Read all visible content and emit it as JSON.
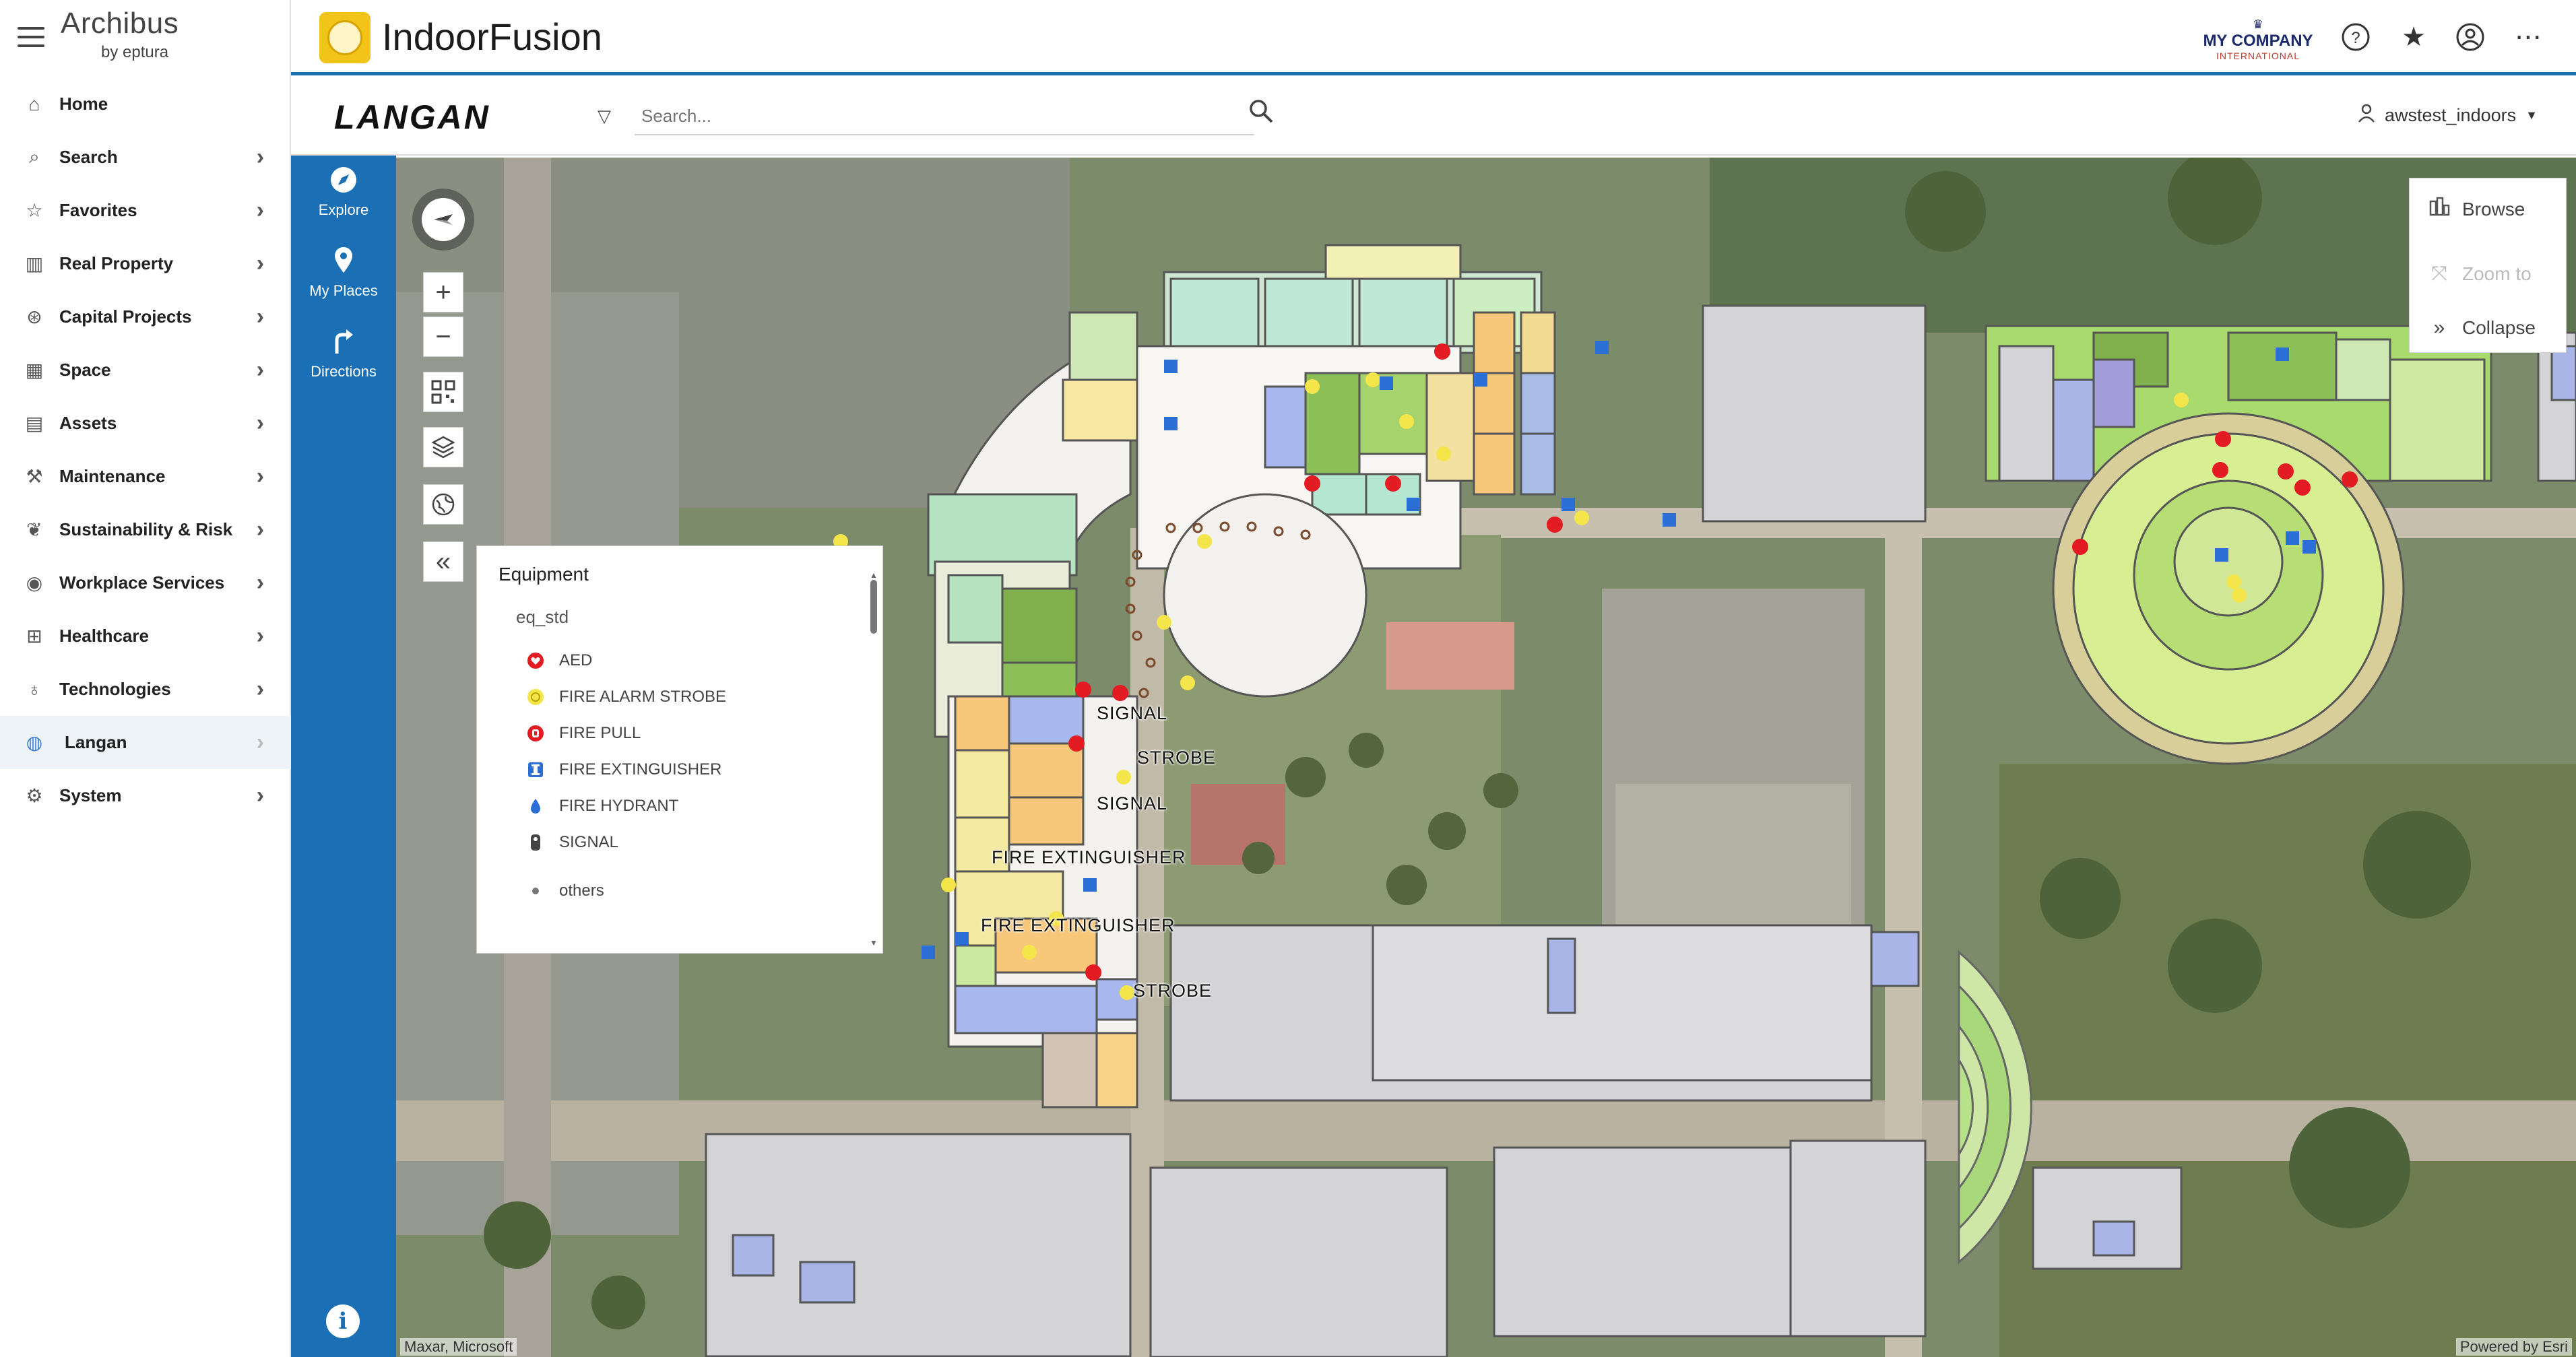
{
  "brand": {
    "name": "Archibus",
    "sub": "by eptura"
  },
  "nav": {
    "items": [
      {
        "label": "Home",
        "icon": "home-icon",
        "chevron": false
      },
      {
        "label": "Search",
        "icon": "search-icon",
        "chevron": true
      },
      {
        "label": "Favorites",
        "icon": "star-icon",
        "chevron": true
      },
      {
        "label": "Real Property",
        "icon": "building-icon",
        "chevron": true
      },
      {
        "label": "Capital Projects",
        "icon": "money-icon",
        "chevron": true
      },
      {
        "label": "Space",
        "icon": "floorplan-icon",
        "chevron": true
      },
      {
        "label": "Assets",
        "icon": "clipboard-icon",
        "chevron": true
      },
      {
        "label": "Maintenance",
        "icon": "wrench-icon",
        "chevron": true
      },
      {
        "label": "Sustainability & Risk",
        "icon": "leaf-icon",
        "chevron": true
      },
      {
        "label": "Workplace Services",
        "icon": "eye-icon",
        "chevron": true
      },
      {
        "label": "Healthcare",
        "icon": "hospital-icon",
        "chevron": true
      },
      {
        "label": "Technologies",
        "icon": "bulb-icon",
        "chevron": true
      },
      {
        "label": "Langan",
        "icon": "globe-icon",
        "chevron": true,
        "active": true
      },
      {
        "label": "System",
        "icon": "gear-icon",
        "chevron": true
      }
    ]
  },
  "app": {
    "title": "IndoorFusion"
  },
  "company": {
    "name": "MY COMPANY",
    "sub": "INTERNATIONAL"
  },
  "header_icons": [
    "help-icon",
    "star-icon",
    "user-circle-icon",
    "more-icon"
  ],
  "searchbar": {
    "logo": "LANGAN",
    "placeholder": "Search...",
    "user": "awstest_indoors"
  },
  "rail": [
    {
      "label": "Explore",
      "icon": "compass-icon"
    },
    {
      "label": "My Places",
      "icon": "pin-icon"
    },
    {
      "label": "Directions",
      "icon": "turn-arrow-icon"
    }
  ],
  "map_controls": [
    "zoom-in-icon",
    "zoom-out-icon",
    "qr-code-icon",
    "layers-icon",
    "basemap-icon",
    "collapse-panel-icon"
  ],
  "legend": {
    "title": "Equipment",
    "field": "eq_std",
    "items": [
      {
        "label": "AED",
        "icon": "aed-icon",
        "color": "#e31b23"
      },
      {
        "label": "FIRE ALARM STROBE",
        "icon": "strobe-icon",
        "color": "#f4e64a"
      },
      {
        "label": "FIRE PULL",
        "icon": "fire-pull-icon",
        "color": "#e31b23"
      },
      {
        "label": "FIRE EXTINGUISHER",
        "icon": "extinguisher-icon",
        "color": "#2b6fd6"
      },
      {
        "label": "FIRE HYDRANT",
        "icon": "hydrant-icon",
        "color": "#2b6fd6"
      },
      {
        "label": "SIGNAL",
        "icon": "signal-icon",
        "color": "#444444"
      },
      {
        "label": "others",
        "icon": "dot-icon",
        "color": "#777777"
      }
    ]
  },
  "right_panel": {
    "browse": "Browse",
    "zoom": "Zoom to",
    "collapse": "Collapse"
  },
  "map_labels": [
    "SIGNAL",
    "STROBE",
    "SIGNAL",
    "FIRE EXTINGUISHER",
    "FIRE EXTINGUISHER",
    "STROBE"
  ],
  "attribution": {
    "left": "Maxar, Microsoft",
    "right": "Powered by Esri"
  },
  "colors": {
    "accent": "#1a6fb5",
    "logo_yellow": "#f0c419"
  }
}
